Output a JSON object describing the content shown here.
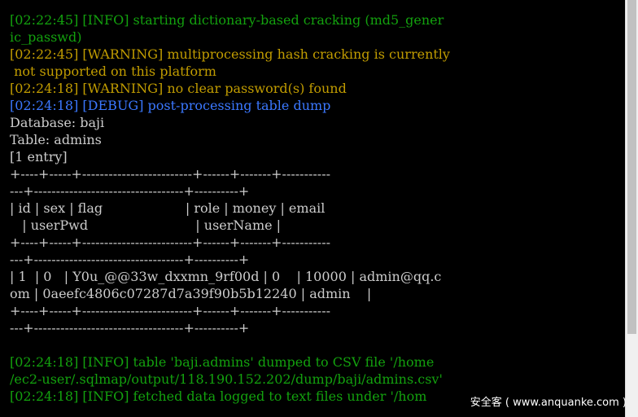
{
  "colors": {
    "background": "#000000",
    "info": "#13a10e",
    "warning": "#c19c00",
    "debug": "#3b78ff",
    "plain": "#cccccc"
  },
  "lines": [
    {
      "text": "[02:22:45] [INFO] starting dictionary-based cracking (md5_gener",
      "style": "green"
    },
    {
      "text": "ic_passwd)",
      "style": "green"
    },
    {
      "text": "[02:22:45] [WARNING] multiprocessing hash cracking is currently",
      "style": "yellow"
    },
    {
      "text": " not supported on this platform",
      "style": "yellow"
    },
    {
      "text": "[02:24:18] [WARNING] no clear password(s) found",
      "style": "yellow"
    },
    {
      "text": "[02:24:18] [DEBUG] post-processing table dump",
      "style": "blue"
    },
    {
      "text": "Database: baji",
      "style": "white"
    },
    {
      "text": "Table: admins",
      "style": "white"
    },
    {
      "text": "[1 entry]",
      "style": "white"
    },
    {
      "text": "+----+-----+-------------------------+------+-------+-----------",
      "style": "white"
    },
    {
      "text": "---+----------------------------------+----------+",
      "style": "white"
    },
    {
      "text": "| id | sex | flag                    | role | money | email",
      "style": "white"
    },
    {
      "text": "   | userPwd                          | userName |",
      "style": "white"
    },
    {
      "text": "+----+-----+-------------------------+------+-------+-----------",
      "style": "white"
    },
    {
      "text": "---+----------------------------------+----------+",
      "style": "white"
    },
    {
      "text": "| 1  | 0   | Y0u_@@33w_dxxmn_9rf00d | 0    | 10000 | admin@qq.c",
      "style": "white"
    },
    {
      "text": "om | 0aeefc4806c07287d7a39f90b5b12240 | admin    |",
      "style": "white"
    },
    {
      "text": "+----+-----+-------------------------+------+-------+-----------",
      "style": "white"
    },
    {
      "text": "---+----------------------------------+----------+",
      "style": "white"
    },
    {
      "text": "",
      "style": "white"
    },
    {
      "text": "[02:24:18] [INFO] table 'baji.admins' dumped to CSV file '/home",
      "style": "green"
    },
    {
      "text": "/ec2-user/.sqlmap/output/118.190.152.202/dump/baji/admins.csv'",
      "style": "green"
    },
    {
      "text": "[02:24:18] [INFO] fetched data logged to text files under '/hom",
      "style": "green"
    }
  ],
  "watermark": "安全客 ( www.anquanke.com )",
  "scrollbar": {
    "visible_fraction": 0.8
  }
}
